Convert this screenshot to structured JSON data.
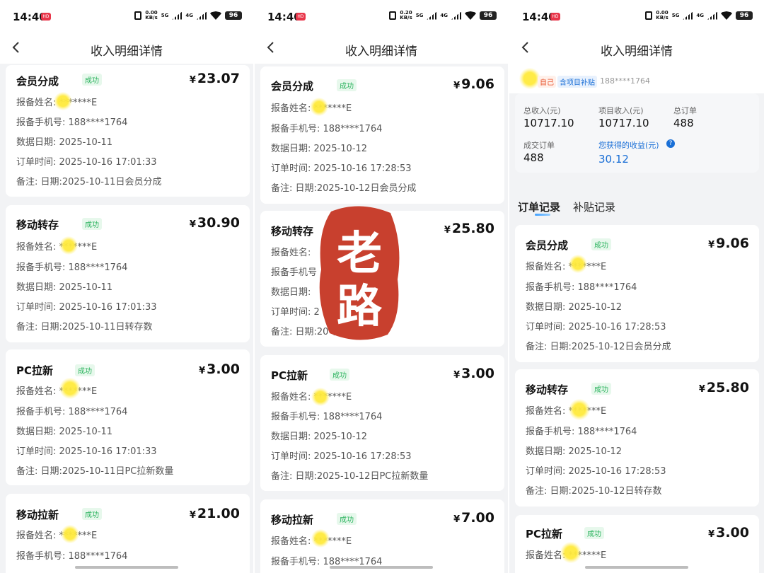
{
  "status": {
    "time": "14:40",
    "hd": "HD",
    "battery": "96",
    "speed": [
      "0.00\nKB/s",
      "0.20\nKB/s",
      "0.00\nKB/s"
    ],
    "network": "5G",
    "network2": "4G"
  },
  "nav": {
    "title": "收入明细详情"
  },
  "panel1": {
    "cards": [
      {
        "name": "会员分成",
        "badge": "成功",
        "amount": "23.07",
        "rows": [
          "报备姓名: *******E",
          "报备手机号: 188****1764",
          "数据日期: 2025-10-11",
          "订单时间: 2025-10-16 17:01:33",
          "备注: 日期:2025-10-11日会员分成"
        ]
      },
      {
        "name": "移动转存",
        "badge": "成功",
        "amount": "30.90",
        "rows": [
          "报备姓名: *******E",
          "报备手机号: 188****1764",
          "数据日期: 2025-10-11",
          "订单时间: 2025-10-16 17:01:33",
          "备注: 日期:2025-10-11日转存数"
        ]
      },
      {
        "name": "PC拉新",
        "badge": "成功",
        "amount": "3.00",
        "rows": [
          "报备姓名: *******E",
          "报备手机号: 188****1764",
          "数据日期: 2025-10-11",
          "订单时间: 2025-10-16 17:01:33",
          "备注: 日期:2025-10-11日PC拉新数量"
        ]
      },
      {
        "name": "移动拉新",
        "badge": "成功",
        "amount": "21.00",
        "rows": [
          "报备姓名: *******E",
          "报备手机号: 188****1764"
        ]
      }
    ]
  },
  "panel2": {
    "cards": [
      {
        "name": "会员分成",
        "badge": "成功",
        "amount": "9.06",
        "rows": [
          "报备姓名: *******E",
          "报备手机号: 188****1764",
          "数据日期: 2025-10-12",
          "订单时间: 2025-10-16 17:28:53",
          "备注: 日期:2025-10-12日会员分成"
        ]
      },
      {
        "name": "移动转存",
        "badge": "成功",
        "amount": "25.80",
        "rows": [
          "报备姓名:",
          "报备手机号",
          "数据日期:",
          "订单时间: 2",
          "备注: 日期:20 转存数"
        ]
      },
      {
        "name": "PC拉新",
        "badge": "成功",
        "amount": "3.00",
        "rows": [
          "报备姓名: *******E",
          "报备手机号: 188****1764",
          "数据日期: 2025-10-12",
          "订单时间: 2025-10-16 17:28:53",
          "备注: 日期:2025-10-12日PC拉新数量"
        ]
      },
      {
        "name": "移动拉新",
        "badge": "成功",
        "amount": "7.00",
        "rows": [
          "报备姓名: *******E",
          "报备手机号: 188****1764"
        ]
      }
    ],
    "stamp_text": "老路"
  },
  "panel3": {
    "tags": {
      "self": "自己",
      "subsidy": "含项目补贴",
      "phone": "188****1764"
    },
    "summary": {
      "total_label": "总收入(元)",
      "total_value": "10717.10",
      "project_label": "项目收入(元)",
      "project_value": "10717.10",
      "orders_label": "总订单",
      "orders_value": "488",
      "deal_label": "成交订单",
      "deal_value": "488",
      "earn_label": "您获得的收益(元)",
      "earn_value": "30.12"
    },
    "tabs": [
      "订单记录",
      "补贴记录"
    ],
    "cards": [
      {
        "name": "会员分成",
        "badge": "成功",
        "amount": "9.06",
        "rows": [
          "报备姓名: *******E",
          "报备手机号: 188****1764",
          "数据日期: 2025-10-12",
          "订单时间: 2025-10-16 17:28:53",
          "备注: 日期:2025-10-12日会员分成"
        ]
      },
      {
        "name": "移动转存",
        "badge": "成功",
        "amount": "25.80",
        "rows": [
          "报备姓名: *******E",
          "报备手机号: 188****1764",
          "数据日期: 2025-10-12",
          "订单时间: 2025-10-16 17:28:53",
          "备注: 日期:2025-10-12日转存数"
        ]
      },
      {
        "name": "PC拉新",
        "badge": "成功",
        "amount": "3.00",
        "rows": [
          "报备姓名: *******E"
        ]
      }
    ]
  },
  "currency": "¥",
  "colors": {
    "success": "#2bb35e",
    "accent": "#1a6fd6",
    "stamp": "#c8402e"
  }
}
